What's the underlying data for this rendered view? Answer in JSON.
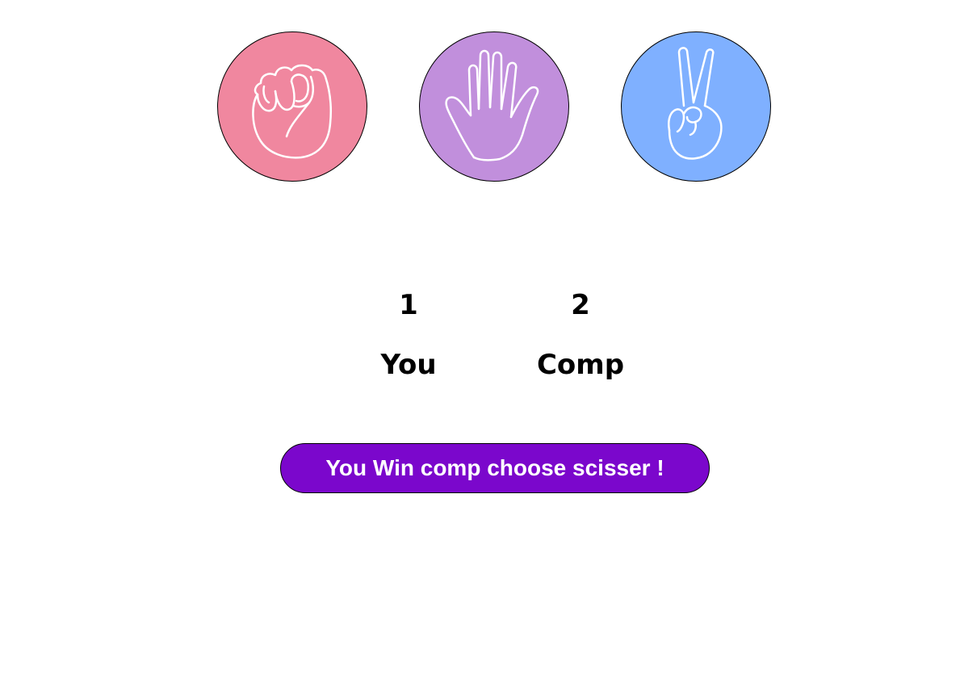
{
  "choices": [
    {
      "id": "rock",
      "icon": "fist-icon",
      "color": "#f0879f"
    },
    {
      "id": "paper",
      "icon": "open-hand-icon",
      "color": "#c18fdc"
    },
    {
      "id": "scissors",
      "icon": "peace-sign-icon",
      "color": "#7fb0ff"
    }
  ],
  "scoreboard": {
    "user_score": "1",
    "user_label": "You",
    "comp_score": "2",
    "comp_label": "Comp"
  },
  "message": {
    "text": "You Win comp choose scisser !",
    "background": "#7b07cc"
  }
}
